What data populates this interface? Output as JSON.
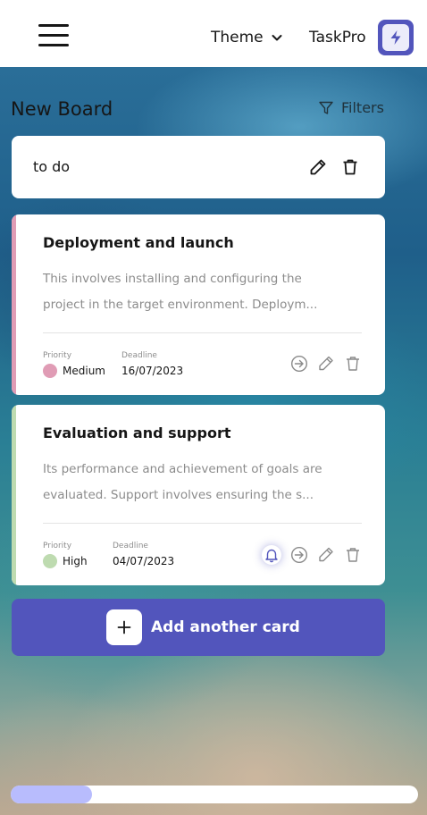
{
  "header": {
    "theme_label": "Theme",
    "brand_name": "TaskPro"
  },
  "board": {
    "title": "New Board",
    "filters_label": "Filters"
  },
  "column": {
    "title": "to do"
  },
  "cards": [
    {
      "title": "Deployment and launch",
      "description": "This involves installing and configuring the project in the target environment. Deploym...",
      "priority_label": "Priority",
      "priority": "Medium",
      "priority_color": "#e09cb5",
      "deadline_label": "Deadline",
      "deadline": "16/07/2023"
    },
    {
      "title": "Evaluation and support",
      "description": "Its performance and achievement of goals are evaluated. Support involves ensuring the s...",
      "priority_label": "Priority",
      "priority": "High",
      "priority_color": "#bedbb0",
      "deadline_label": "Deadline",
      "deadline": "04/07/2023"
    }
  ],
  "add_card_label": "Add another card",
  "scrollbar": {
    "position_fraction": 0.2
  },
  "colors": {
    "accent": "#5255bc",
    "scroll_thumb": "#b8bcfd"
  }
}
